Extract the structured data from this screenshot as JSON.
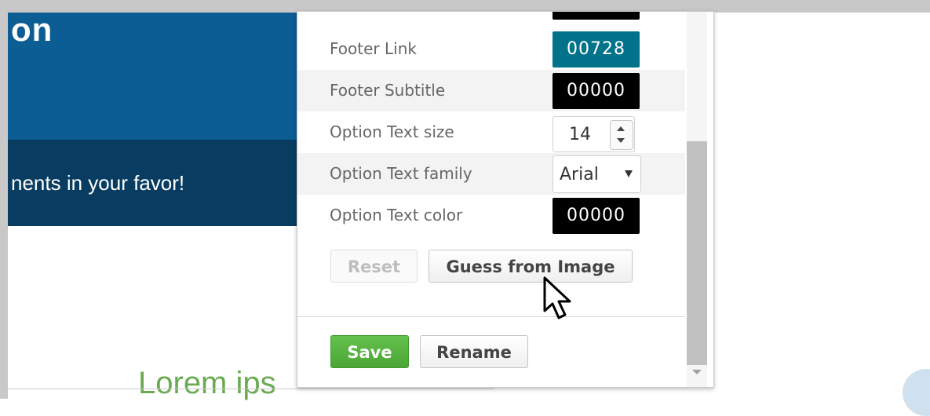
{
  "background": {
    "title_fragment": "on",
    "subtitle_fragment": "nents in your favor!",
    "lorem_fragment": "Lorem ips"
  },
  "settings": {
    "rows": [
      {
        "label": "Footer Link",
        "control": "color",
        "value": "00728",
        "color": "#007289"
      },
      {
        "label": "Footer Subtitle",
        "control": "color",
        "value": "00000",
        "color": "#000000"
      },
      {
        "label": "Option Text size",
        "control": "number",
        "value": "14"
      },
      {
        "label": "Option Text family",
        "control": "select",
        "value": "Arial"
      },
      {
        "label": "Option Text color",
        "control": "color",
        "value": "00000",
        "color": "#000000"
      }
    ]
  },
  "buttons": {
    "reset": "Reset",
    "guess": "Guess from Image",
    "save": "Save",
    "rename": "Rename"
  },
  "colors": {
    "header_blue": "#0b5d94",
    "header_dark": "#083c60",
    "accent_green": "#5bb544",
    "teal": "#007289"
  }
}
